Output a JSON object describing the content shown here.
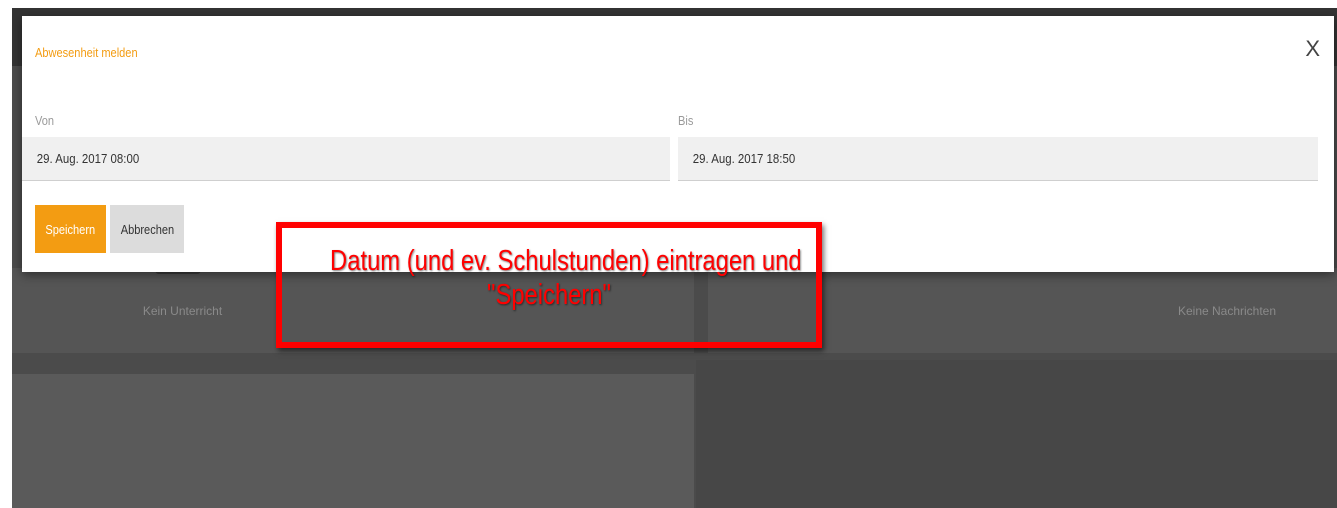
{
  "background": {
    "card_left_label": "Kein Unterricht",
    "card_right_label": "Keine Nachrichten"
  },
  "modal": {
    "title": "Abwesenheit melden",
    "close_label": "X",
    "from": {
      "label": "Von",
      "value": "29. Aug. 2017 08:00"
    },
    "to": {
      "label": "Bis",
      "value": "29. Aug. 2017 18:50"
    },
    "save_label": "Speichern",
    "cancel_label": "Abbrechen"
  },
  "callout": {
    "line1": "Datum (und ev. Schulstunden) eintragen und",
    "line2": "\"Speichern\""
  },
  "colors": {
    "accent": "#f39c12",
    "annotation": "#ff0000",
    "overlay": "#4b4b4b"
  }
}
